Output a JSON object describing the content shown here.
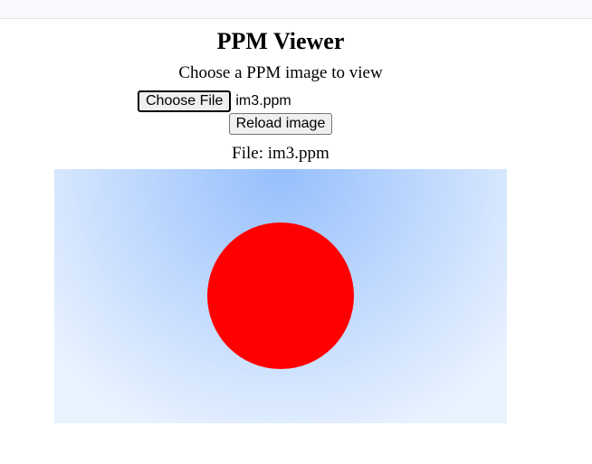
{
  "page": {
    "title": "PPM Viewer",
    "subtitle": "Choose a PPM image to view",
    "choose_file_label": "Choose File",
    "selected_file": "im3.ppm",
    "reload_label": "Reload image",
    "file_info": "File: im3.ppm"
  },
  "image": {
    "description": "sky-blue gradient background with a red circle",
    "gradient_top_color": "#95bffc",
    "gradient_bottom_color": "#e9f2ff",
    "circle_color": "#ff0000"
  }
}
